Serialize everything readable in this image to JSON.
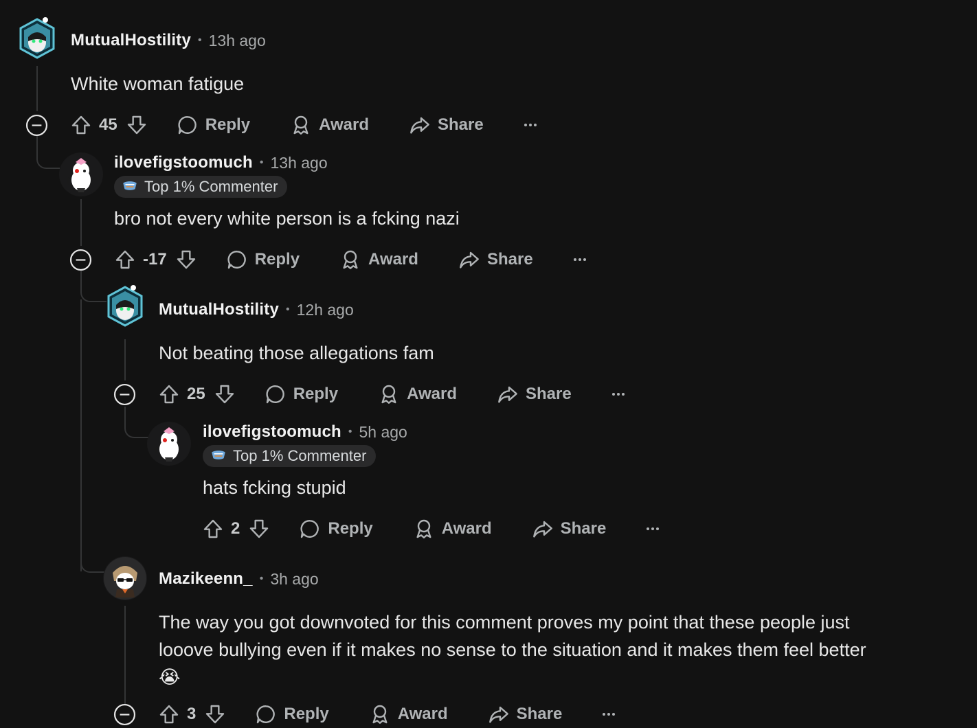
{
  "comments": [
    {
      "username": "MutualHostility",
      "time": "13h ago",
      "body": "White woman fatigue",
      "score": "45",
      "actions": {
        "reply": "Reply",
        "award": "Award",
        "share": "Share"
      }
    },
    {
      "username": "ilovefigstoomuch",
      "time": "13h ago",
      "badge": "Top 1% Commenter",
      "body": "bro not every white person is a fcking nazi",
      "score": "-17",
      "actions": {
        "reply": "Reply",
        "award": "Award",
        "share": "Share"
      }
    },
    {
      "username": "MutualHostility",
      "time": "12h ago",
      "body": "Not beating those allegations fam",
      "score": "25",
      "actions": {
        "reply": "Reply",
        "award": "Award",
        "share": "Share"
      }
    },
    {
      "username": "ilovefigstoomuch",
      "time": "5h ago",
      "badge": "Top 1% Commenter",
      "body": "hats fcking stupid",
      "score": "2",
      "actions": {
        "reply": "Reply",
        "award": "Award",
        "share": "Share"
      }
    },
    {
      "username": "Mazikeenn_",
      "time": "3h ago",
      "body": "The way you got downvoted for this comment proves my point that these people just looove bullying even if it makes no sense to the situation and it makes them feel better 😭",
      "score": "3",
      "actions": {
        "reply": "Reply",
        "award": "Award",
        "share": "Share"
      }
    }
  ],
  "icons": {
    "upvote": "arrow-up-icon",
    "downvote": "arrow-down-icon",
    "reply": "speech-bubble-icon",
    "award": "award-ribbon-icon",
    "share": "share-arrow-icon",
    "more": "ellipsis-icon",
    "collapse": "minus-circle-icon"
  },
  "colors": {
    "background": "#121212",
    "thread_line": "#343536",
    "badge_bg": "#2a2a2b",
    "muted": "#b0b3b5"
  }
}
